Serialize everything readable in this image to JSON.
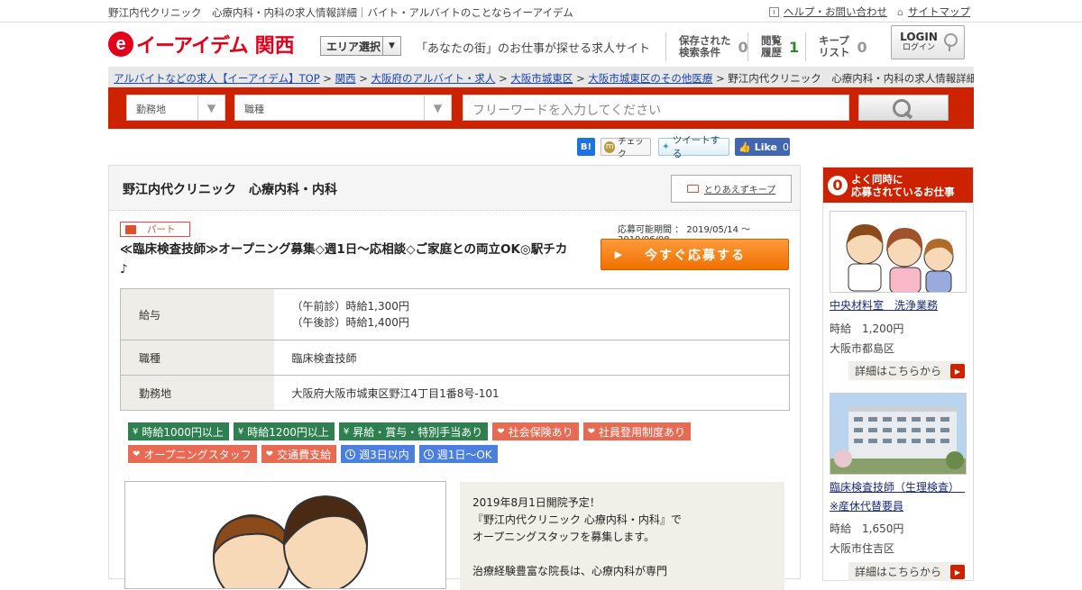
{
  "topbar": {
    "site_title": "野江内代クリニック　心療内科・内科の求人情報詳細｜バイト・アルバイトのことならイーアイデム",
    "help_label": "ヘルプ・お問い合わせ",
    "sitemap_label": "サイトマップ"
  },
  "header": {
    "logo_mark": "e",
    "logo_text": "イーアイデム",
    "region": "関西",
    "area_select_label": "エリア選択",
    "tagline": "「あなたの街」のお仕事が探せる求人サイト",
    "saved_conditions_label": "保存された\n検索条件",
    "saved_conditions_count": "0",
    "history_label": "閲覧\n履歴",
    "history_count": "1",
    "keep_list_label": "キープ\nリスト",
    "keep_list_count": "0",
    "login_label": "LOGIN",
    "login_sub": "ログイン"
  },
  "breadcrumb": {
    "items": [
      "アルバイトなどの求人【イーアイデム】TOP",
      "関西",
      "大阪府のアルバイト・求人",
      "大阪市城東区",
      "大阪市城東区のその他医療"
    ],
    "separator": ">",
    "current": "野江内代クリニック　心療内科・内科の求人情報詳細"
  },
  "search": {
    "location_label": "勤務地",
    "job_type_label": "職種",
    "freeword_placeholder": "フリーワードを入力してください"
  },
  "social": {
    "hatena": "B!",
    "mixi_check": "チェック",
    "tweet": "ツイートする",
    "fb_like": "Like",
    "fb_count": "0"
  },
  "job": {
    "company_title": "野江内代クリニック　心療内科・内科",
    "keep_button": "とりあえずキープ",
    "employment_type": "パート",
    "period": "応募可能期間 ： 2019/05/14 ～ 2019/06/08",
    "title": "≪臨床検査技師≫オープニング募集◇週1日〜応相談◇ご家庭との両立OK◎駅チカ♪",
    "apply_button": "今すぐ応募する",
    "details": [
      {
        "label": "給与",
        "value": "（午前診）時給1,300円\n（午後診）時給1,400円"
      },
      {
        "label": "職種",
        "value": "臨床検査技師"
      },
      {
        "label": "勤務地",
        "value": "大阪府大阪市城東区野江4丁目1番8号-101"
      }
    ],
    "tags": [
      {
        "text": "時給1000円以上",
        "color": "green",
        "icon": "yen-icon"
      },
      {
        "text": "時給1200円以上",
        "color": "green",
        "icon": "yen-icon"
      },
      {
        "text": "昇給・賞与・特別手当あり",
        "color": "green",
        "icon": "yen-icon"
      },
      {
        "text": "社会保険あり",
        "color": "orange",
        "icon": "heart-icon"
      },
      {
        "text": "社員登用制度あり",
        "color": "orange",
        "icon": "heart-icon"
      },
      {
        "text": "オープニングスタッフ",
        "color": "orange",
        "icon": "heart-icon"
      },
      {
        "text": "交通費支給",
        "color": "orange",
        "icon": "heart-icon"
      },
      {
        "text": "週3日以内",
        "color": "blue",
        "icon": "clock-icon"
      },
      {
        "text": "週1日～OK",
        "color": "blue",
        "icon": "clock-icon"
      }
    ],
    "description": "2019年8月1日開院予定！\n『野江内代クリニック 心療内科・内科』で\nオープニングスタッフを募集します。\n\n治療経験豊富な院長は、心療内科が専門"
  },
  "sidebar": {
    "heading_mark": "0",
    "heading": "よく同時に\n応募されているお仕事",
    "items": [
      {
        "title": "中央材料室　洗浄業務",
        "wage": "時給　1,200円",
        "location": "大阪市都島区",
        "more": "詳細はこちらから"
      },
      {
        "title": "臨床検査技師（生理検査）　※産休代替要員",
        "wage": "時給　1,650円",
        "location": "大阪市住吉区",
        "more": "詳細はこちらから"
      }
    ]
  },
  "colors": {
    "brand_red": "#e2001a",
    "search_bar": "#cc2200",
    "apply_orange": "#f07000",
    "tag_green": "#2e8050",
    "tag_orange": "#e86a52",
    "tag_blue": "#4a7ee0"
  }
}
